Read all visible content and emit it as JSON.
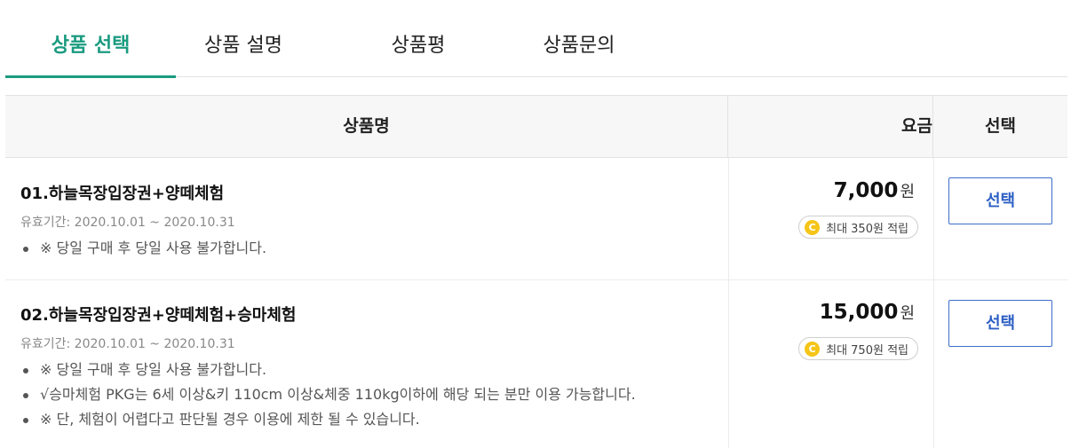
{
  "tabs": [
    {
      "label": "상품 선택",
      "active": true
    },
    {
      "label": "상품 설명",
      "active": false
    },
    {
      "label": "상품평",
      "active": false
    },
    {
      "label": "상품문의",
      "active": false
    }
  ],
  "table": {
    "headers": {
      "name": "상품명",
      "price": "요금",
      "select": "선택"
    },
    "rows": [
      {
        "name": "01.하늘목장입장권+양떼체험",
        "validity": "유효기간: 2020.10.01 ~ 2020.10.31",
        "notes": [
          "※ 당일 구매 후 당일 사용 불가합니다."
        ],
        "price": "7,000",
        "unit": "원",
        "points": "최대 350원 적립",
        "select_label": "선택"
      },
      {
        "name": "02.하늘목장입장권+양떼체험+승마체험",
        "validity": "유효기간: 2020.10.01 ~ 2020.10.31",
        "notes": [
          "※ 당일 구매 후 당일 사용 불가합니다.",
          "√승마체험 PKG는 6세 이상&키 110cm 이상&체중 110kg이하에 해당 되는 분만 이용 가능합니다.",
          "※ 단, 체험이 어렵다고 판단될 경우 이용에 제한 될 수 있습니다."
        ],
        "price": "15,000",
        "unit": "원",
        "points": "최대 750원 적립",
        "select_label": "선택"
      }
    ]
  },
  "icons": {
    "coin": "C"
  },
  "colors": {
    "accent": "#1a9b80",
    "button": "#2d5fc4",
    "coin": "#f5c518"
  }
}
